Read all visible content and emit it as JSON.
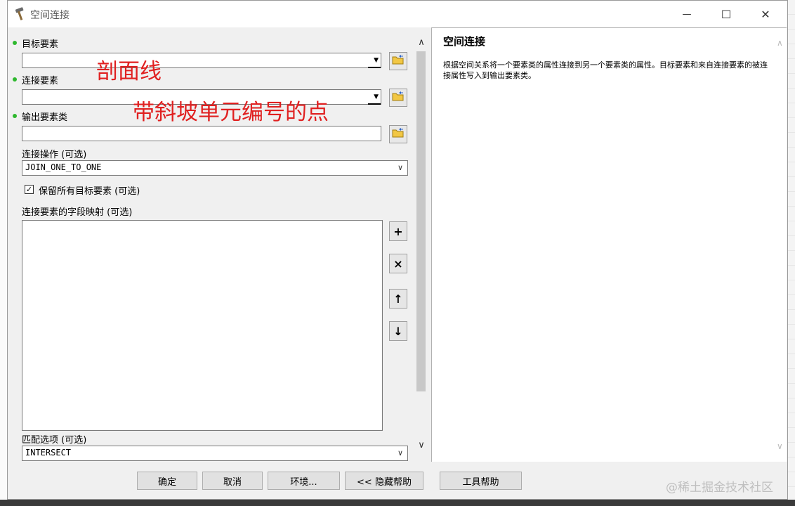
{
  "window": {
    "title": "空间连接",
    "minimize_glyph": "—",
    "maximize_glyph": "☐",
    "close_glyph": "✕"
  },
  "form": {
    "target_features": {
      "label": "目标要素",
      "value": ""
    },
    "join_features": {
      "label": "连接要素",
      "value": ""
    },
    "output_feature_class": {
      "label": "输出要素类",
      "value": ""
    },
    "join_operation": {
      "label": "连接操作 (可选)",
      "value": "JOIN_ONE_TO_ONE"
    },
    "keep_all_targets": {
      "label": "保留所有目标要素 (可选)",
      "checked": true,
      "check_glyph": "✓"
    },
    "field_mapping": {
      "label": "连接要素的字段映射 (可选)"
    },
    "match_option": {
      "label": "匹配选项 (可选)",
      "value": "INTERSECT"
    }
  },
  "field_map_buttons": {
    "add": "+",
    "remove": "×",
    "move_up": "↑",
    "move_down": "↓"
  },
  "annotations": {
    "target": "剖面线",
    "join": "带斜坡单元编号的点"
  },
  "help": {
    "title": "空间连接",
    "body": "根据空间关系将一个要素类的属性连接到另一个要素类的属性。目标要素和来自连接要素的被连接属性写入到输出要素类。"
  },
  "buttons": {
    "ok": "确定",
    "cancel": "取消",
    "environments": "环境...",
    "hide_help": "<< 隐藏帮助",
    "tool_help": "工具帮助"
  },
  "watermark": "@稀土掘金技术社区",
  "icons": {
    "title": "hammer-icon",
    "browse": "folder-open-icon"
  }
}
